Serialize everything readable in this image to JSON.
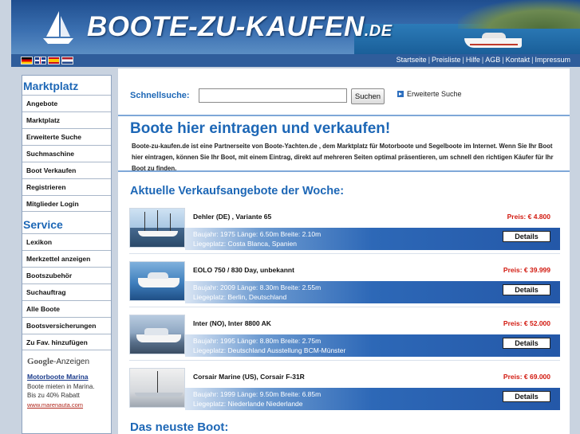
{
  "header": {
    "logo_text": "BOOTE-ZU-KAUFEN",
    "logo_tld": ".DE"
  },
  "topnav": {
    "flags": [
      "flag-de-icon",
      "flag-uk-icon",
      "flag-es-icon",
      "flag-nl-icon"
    ],
    "links": [
      "Startseite",
      "Preisliste",
      "Hilfe",
      "AGB",
      "Kontakt",
      "Impressum"
    ]
  },
  "sidebar": {
    "marktplatz_heading": "Marktplatz",
    "marktplatz_items": [
      "Angebote",
      "Marktplatz",
      "Erweiterte Suche",
      "Suchmaschine",
      "Boot Verkaufen",
      "Registrieren",
      "Mitglieder Login"
    ],
    "service_heading": "Service",
    "service_items": [
      "Lexikon",
      "Merkzettel anzeigen",
      "Bootszubehör",
      "Suchauftrag",
      "Alle Boote",
      "Bootsversicherungen",
      "Zu Fav. hinzufügen"
    ],
    "ads": {
      "google_label": "Google",
      "anzeigen_label": "-Anzeigen",
      "ad_title": "Motorboote Marina",
      "ad_text": "Boote mieten in Marina. Bis zu 40% Rabatt",
      "ad_url": "www.marenauta.com"
    }
  },
  "search": {
    "label": "Schnellsuche:",
    "value": "",
    "button_label": "Suchen",
    "advanced_label": "Erweiterte Suche"
  },
  "promo": {
    "title": "Boote hier eintragen und verkaufen!",
    "text": "Boote-zu-kaufen.de ist eine Partnerseite von Boote-Yachten.de , dem Marktplatz für Motorboote und Segelboote im Internet. Wenn Sie Ihr Boot hier eintragen, können Sie Ihr Boot, mit einem Eintrag, direkt auf mehreren Seiten optimal präsentieren, um schnell den richtigen Käufer für Ihr Boot zu finden."
  },
  "offers": {
    "title": "Aktuelle Verkaufsangebote der Woche:",
    "details_label": "Details",
    "items": [
      {
        "name": "Dehler (DE) , Variante 65",
        "price": "Preis: € 4.800",
        "specs": "Baujahr: 1975 Länge: 6.50m Breite: 2.10m",
        "location": "Liegeplatz: Costa Blanca, Spanien"
      },
      {
        "name": "EOLO 750 / 830 Day, unbekannt",
        "price": "Preis: € 39.999",
        "specs": "Baujahr: 2009 Länge: 8.30m Breite: 2.55m",
        "location": "Liegeplatz: Berlin, Deutschland"
      },
      {
        "name": "Inter (NO), Inter 8800 AK",
        "price": "Preis: € 52.000",
        "specs": "Baujahr: 1995 Länge: 8.80m Breite: 2.75m",
        "location": "Liegeplatz: Deutschland Ausstellung BCM-Münster"
      },
      {
        "name": "Corsair Marine (US), Corsair F-31R",
        "price": "Preis: € 69.000",
        "specs": "Baujahr: 1999 Länge: 9.50m Breite: 6.85m",
        "location": "Liegeplatz: Niederlande Niederlande"
      }
    ]
  },
  "newest": {
    "title": "Das neuste Boot:"
  },
  "colors": {
    "accent_blue": "#1d67b6",
    "price_red": "#d2190f",
    "header_blue": "#2f5d9b"
  }
}
